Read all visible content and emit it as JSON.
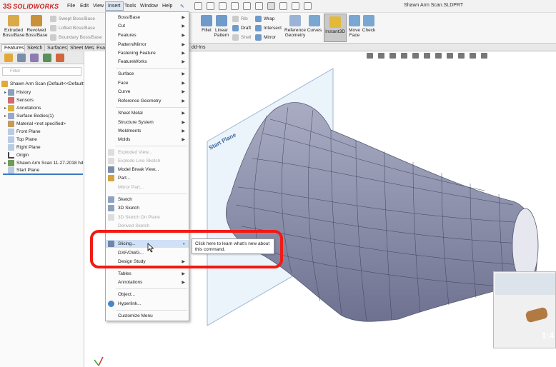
{
  "app": {
    "brand": "SOLIDWORKS",
    "doc_title": "Shawn Arm Scan.SLDPRT"
  },
  "menubar": [
    "File",
    "Edit",
    "View",
    "Insert",
    "Tools",
    "Window",
    "Help"
  ],
  "ribbon": {
    "extruded_boss": "Extruded Boss/Base",
    "revolved_boss": "Revolved Boss/Base",
    "swept_boss": "Swept Boss/Base",
    "lofted_boss": "Lofted Boss/Base",
    "boundary_boss": "Boundary Boss/Base",
    "fillet": "Fillet",
    "linear_pattern": "Linear Pattern",
    "rib": "Rib",
    "draft": "Draft",
    "shell": "Shell",
    "wrap": "Wrap",
    "intersect": "Intersect",
    "mirror": "Mirror",
    "reference_geometry": "Reference Geometry",
    "curves": "Curves",
    "instant3d": "Instant3D",
    "move_face": "Move Face",
    "check": "Check"
  },
  "tabs": [
    "Features",
    "Sketch",
    "Surfaces",
    "Sheet Metal",
    "Eval",
    "dd-Ins"
  ],
  "tree": {
    "filter_placeholder": "Filter",
    "root": "Shawn Arm Scan  (Default<<Default>",
    "items": [
      "History",
      "Sensors",
      "Annotations",
      "Surface Bodies(1)",
      "Material <not specified>",
      "Front Plane",
      "Top Plane",
      "Right Plane",
      "Origin",
      "Shawn Arm Scan 11-27-2018 hd tr",
      "Start Plane"
    ]
  },
  "dropdown": {
    "items": [
      "Boss/Base",
      "Cut",
      "Features",
      "Pattern/Mirror",
      "Fastening Feature",
      "FeatureWorks",
      "Surface",
      "Face",
      "Curve",
      "Reference Geometry",
      "Sheet Metal",
      "Structure System",
      "Weldments",
      "Molds",
      "Exploded View...",
      "Explode Line Sketch",
      "Model Break View...",
      "Part...",
      "Mirror Part...",
      "Sketch",
      "3D Sketch",
      "3D Sketch On Plane",
      "Derived Sketch",
      "Slicing...",
      "DXF/DWG...",
      "Design Study",
      "Tables",
      "Annotations",
      "Object...",
      "Hyperlink...",
      "Customize Menu"
    ]
  },
  "tooltip": "Click here to learn what's new about this command.",
  "viewport": {
    "plane_label": "Start Plane"
  },
  "thumb": {
    "time_text": "1:4"
  },
  "colors": {
    "brand": "#cc1f1f",
    "highlight": "#ef1b14",
    "mesh": "#8a8ea8",
    "plane": "#cfe0f2"
  }
}
